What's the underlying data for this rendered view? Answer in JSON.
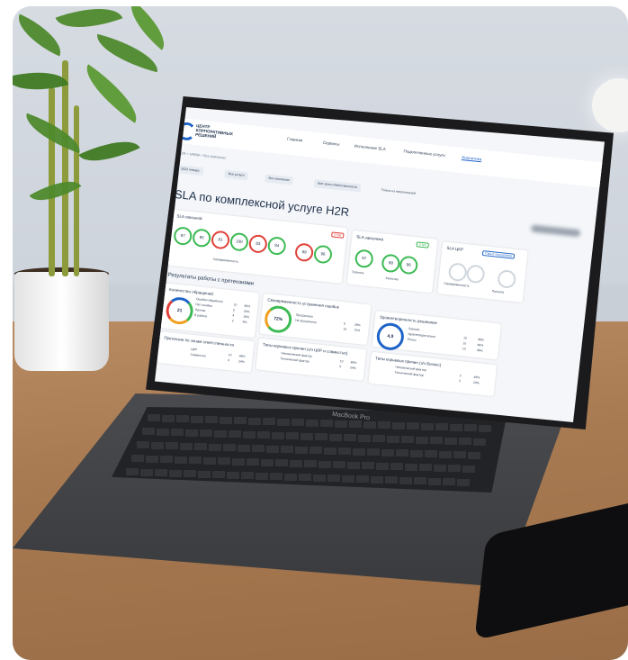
{
  "screen": {
    "nav": {
      "logo_text": "ЦЕНТР КОРПОРАТИВНЫХ РЕШЕНИЙ",
      "items": [
        "Главная",
        "Сервисы",
        "Исполнение SLA",
        "Подключенные услуги",
        "Аналитика"
      ]
    },
    "breadcrumb": "H2R  >  HRBM  >  Все компании",
    "filters": [
      "2023 январь",
      "Все услуги",
      "Все компании",
      "Все зоны ответственности"
    ],
    "checkbox_label": "Только из исполнителей",
    "title": "SLA по комплексной услуге H2R",
    "sla_overall": {
      "title": "SLA сквозной",
      "gauges": [
        "97",
        "95",
        "81",
        "100",
        "83",
        "94",
        "89",
        "96"
      ],
      "badge": "0 NA",
      "footer": "Своевременность"
    },
    "sla_customer": {
      "title": "SLA заказчика",
      "badge": "0 NA",
      "gauges": [
        "97",
        "98",
        "96"
      ],
      "footer_left": "Полнота",
      "footer_right": "Качество"
    },
    "sla_ckr": {
      "title": "SLA ЦКР",
      "link": "Скрыт показатели",
      "footer_left": "Своевременность",
      "footer_right": "Полнота"
    },
    "claims_title": "Результаты работы с претензиями",
    "claims_count": {
      "title": "Количество обращений",
      "total": "21",
      "items": [
        {
          "label": "Ошибки обработки",
          "value": "10",
          "pct": "48%"
        },
        {
          "label": "Нет ошибки",
          "value": "5",
          "pct": "24%"
        },
        {
          "label": "Прочие",
          "value": "4",
          "pct": "19%"
        },
        {
          "label": "В работе",
          "value": "2",
          "pct": "9%"
        }
      ]
    },
    "timeliness": {
      "title": "Своевременность устранения ошибок",
      "value": "72%",
      "items": [
        {
          "label": "Просрочено",
          "value": "6",
          "pct": "28%"
        },
        {
          "label": "Не просрочено",
          "value": "15",
          "pct": "72%"
        }
      ]
    },
    "satisfaction": {
      "title": "Удовлетворенность решением",
      "value": "4,9",
      "items": [
        {
          "label": "Хорошо",
          "value": "10",
          "pct": "48%"
        },
        {
          "label": "Удовлетворительно",
          "value": "10",
          "pct": "48%"
        },
        {
          "label": "Плохо",
          "value": "10",
          "pct": "48%"
        }
      ]
    },
    "zones": {
      "title": "Претензии по зонам ответственности",
      "items": [
        {
          "label": "ЦКР",
          "value": "10",
          "pct": "48%"
        },
        {
          "label": "Совместно",
          "value": "4",
          "pct": "24%"
        }
      ]
    },
    "root_causes_ckr": {
      "title": "Типы корневых причин (з/з ЦКР и совместно)",
      "items": [
        {
          "label": "Человеческий фактор",
          "value": "10",
          "pct": "48%"
        },
        {
          "label": "Технический фактор",
          "value": "4",
          "pct": "24%"
        }
      ]
    },
    "root_causes_business": {
      "title": "Типы корневых причин (з/з Бизнес)",
      "items": [
        {
          "label": "Человеческий фактор",
          "value": "2",
          "pct": "48%"
        },
        {
          "label": "Технический фактор",
          "value": "2",
          "pct": "24%"
        }
      ]
    }
  },
  "laptop_label": "MacBook Pro"
}
